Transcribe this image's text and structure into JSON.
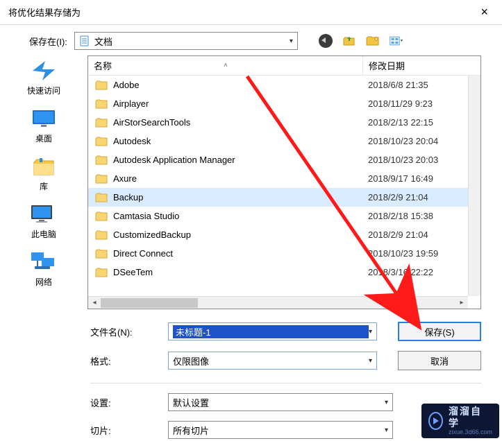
{
  "window": {
    "title": "将优化结果存储为"
  },
  "topbar": {
    "save_in_label": "保存在(I):",
    "location": "文档"
  },
  "sidebar": {
    "items": [
      {
        "label": "快速访问"
      },
      {
        "label": "桌面"
      },
      {
        "label": "库"
      },
      {
        "label": "此电脑"
      },
      {
        "label": "网络"
      }
    ]
  },
  "list": {
    "col_name": "名称",
    "col_date": "修改日期",
    "rows": [
      {
        "name": "Adobe",
        "date": "2018/6/8 21:35"
      },
      {
        "name": "Airplayer",
        "date": "2018/11/29 9:23"
      },
      {
        "name": "AirStorSearchTools",
        "date": "2018/2/13 22:15"
      },
      {
        "name": "Autodesk",
        "date": "2018/10/23 20:04"
      },
      {
        "name": "Autodesk Application Manager",
        "date": "2018/10/23 20:03"
      },
      {
        "name": "Axure",
        "date": "2018/9/17 16:49"
      },
      {
        "name": "Backup",
        "date": "2018/2/9 21:04",
        "selected": true
      },
      {
        "name": "Camtasia Studio",
        "date": "2018/2/18 15:38"
      },
      {
        "name": "CustomizedBackup",
        "date": "2018/2/9 21:04"
      },
      {
        "name": "Direct Connect",
        "date": "2018/10/23 19:59"
      },
      {
        "name": "DSeeTem",
        "date": "2018/3/16 22:22"
      }
    ]
  },
  "fields": {
    "filename_label": "文件名(N):",
    "filename_value": "未标题-1",
    "format_label": "格式:",
    "format_value": "仅限图像",
    "save_btn": "保存(S)",
    "cancel_btn": "取消",
    "settings_label": "设置:",
    "settings_value": "默认设置",
    "slice_label": "切片:",
    "slice_value": "所有切片"
  },
  "watermark": {
    "line1": "溜溜自学",
    "line2": "zixue.3d66.com"
  }
}
